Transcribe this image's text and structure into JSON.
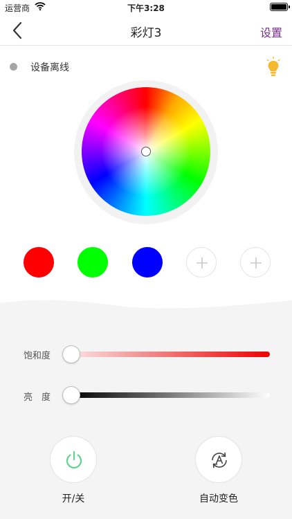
{
  "status_bar": {
    "carrier": "运营商",
    "time": "下午3:28",
    "wifi_icon": "wifi-icon",
    "battery_icon": "battery-icon"
  },
  "nav": {
    "title": "彩灯3",
    "settings_label": "设置",
    "back_icon": "chevron-left-icon"
  },
  "device": {
    "status_label": "设备离线",
    "status_color": "#a6a6a6",
    "bulb_icon": "bulb-icon",
    "bulb_color": "#f5b82e"
  },
  "presets": [
    {
      "color": "#ff0000"
    },
    {
      "color": "#00ff00"
    },
    {
      "color": "#0000ff"
    },
    {
      "empty": true,
      "icon": "plus-icon"
    },
    {
      "empty": true,
      "icon": "plus-icon"
    }
  ],
  "sliders": {
    "saturation": {
      "label": "饱和度",
      "value": 0
    },
    "brightness": {
      "label": "亮　度",
      "value": 0
    }
  },
  "buttons": {
    "power": {
      "label": "开/关",
      "icon": "power-icon",
      "color": "#5fd38a"
    },
    "auto": {
      "label": "自动变色",
      "icon": "auto-mode-icon"
    }
  },
  "colors": {
    "accent": "#7b2b8f",
    "panel_bg": "#f4f4f4"
  }
}
